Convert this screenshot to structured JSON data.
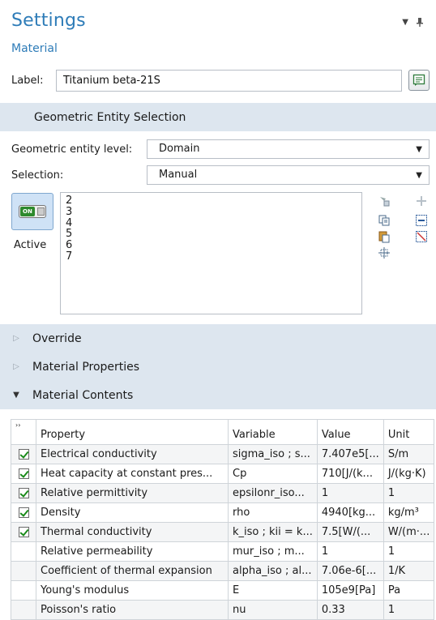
{
  "header": {
    "title": "Settings",
    "subtitle": "Material",
    "label_caption": "Label:",
    "label_value": "Titanium beta-21S"
  },
  "geo_section": {
    "title": "Geometric Entity Selection",
    "entity_level_caption": "Geometric entity level:",
    "entity_level_value": "Domain",
    "selection_caption": "Selection:",
    "selection_value": "Manual",
    "toggle_text": "ON",
    "active_label": "Active",
    "selected_items": [
      "2",
      "3",
      "4",
      "5",
      "6",
      "7"
    ]
  },
  "sections": {
    "override": "Override",
    "material_properties": "Material Properties",
    "material_contents": "Material Contents"
  },
  "table": {
    "corner": "››",
    "columns": [
      "Property",
      "Variable",
      "Value",
      "Unit"
    ],
    "rows": [
      {
        "checked": true,
        "property": "Electrical conductivity",
        "variable": "sigma_iso ; s...",
        "value": "7.407e5[...",
        "unit": "S/m"
      },
      {
        "checked": true,
        "property": "Heat capacity at constant pres...",
        "variable": "Cp",
        "value": "710[J/(k...",
        "unit": "J/(kg·K)"
      },
      {
        "checked": true,
        "property": "Relative permittivity",
        "variable": "epsilonr_iso...",
        "value": "1",
        "unit": "1"
      },
      {
        "checked": true,
        "property": "Density",
        "variable": "rho",
        "value": "4940[kg...",
        "unit": "kg/m³"
      },
      {
        "checked": true,
        "property": "Thermal conductivity",
        "variable": "k_iso ; kii = k...",
        "value": "7.5[W/(...",
        "unit": "W/(m·..."
      },
      {
        "checked": false,
        "property": "Relative permeability",
        "variable": "mur_iso ; m...",
        "value": "1",
        "unit": "1"
      },
      {
        "checked": false,
        "property": "Coefficient of thermal expansion",
        "variable": "alpha_iso ; al...",
        "value": "7.06e-6[...",
        "unit": "1/K"
      },
      {
        "checked": false,
        "property": "Young's modulus",
        "variable": "E",
        "value": "105e9[Pa]",
        "unit": "Pa"
      },
      {
        "checked": false,
        "property": "Poisson's ratio",
        "variable": "nu",
        "value": "0.33",
        "unit": "1"
      }
    ]
  },
  "colors": {
    "accent": "#2e7cb8",
    "section_bg": "#dde6ef",
    "check_green": "#1a8a1a"
  }
}
